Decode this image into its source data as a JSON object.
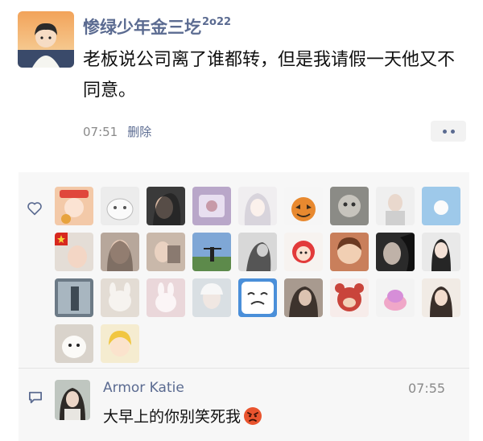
{
  "post": {
    "username": "惨绿少年金三圪",
    "username_sup": "2o22",
    "content": "老板说公司离了谁都转，但是我请假一天他又不同意。",
    "time": "07:51",
    "delete_label": "删除"
  },
  "likes": {
    "icon": "heart-outline-icon",
    "count_avatars": 29
  },
  "comment": {
    "icon": "comment-bubble-icon",
    "author": "Armor Katie",
    "time": "07:55",
    "text": "大早上的你别笑死我",
    "emoji": "angry-face-emoji"
  },
  "colors": {
    "link_blue": "#5b6b91",
    "panel_bg": "#f7f7f7",
    "meta_gray": "#8a8a8a"
  }
}
